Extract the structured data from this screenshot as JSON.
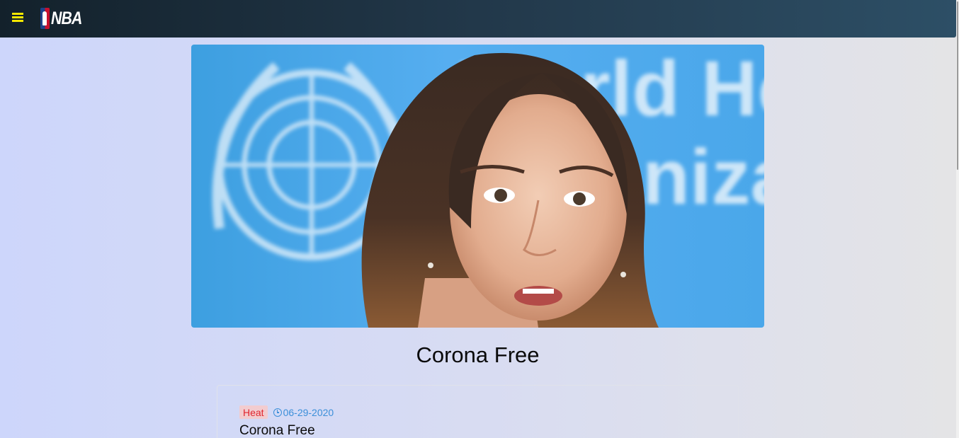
{
  "header": {
    "menu_icon": "hamburger-menu-icon",
    "logo_text": "NBA",
    "accent_color": "#f5e800"
  },
  "article": {
    "title": "Corona Free",
    "image_alt": "Woman speaking in front of a World Health Organization backdrop",
    "tag": "Heat",
    "tag_color": "#e0262e",
    "date": "06-29-2020",
    "date_icon": "clock-icon",
    "date_color": "#3b8fd9",
    "card_title": "Corona Free"
  }
}
